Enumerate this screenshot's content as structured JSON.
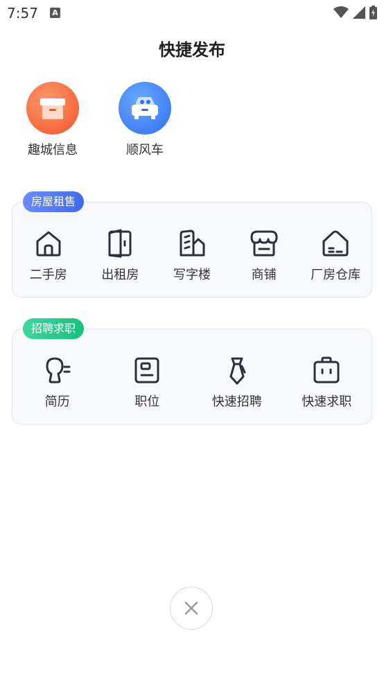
{
  "status_bar": {
    "time": "7:57",
    "notification_badge": "A"
  },
  "header": {
    "title": "快捷发布"
  },
  "quick_actions": [
    {
      "label": "趣城信息",
      "icon": "box-icon",
      "color": "#f0522a"
    },
    {
      "label": "顺风车",
      "icon": "car-icon",
      "color": "#2f6ef2"
    }
  ],
  "sections": {
    "housing": {
      "tag": "房屋租售",
      "items": [
        {
          "label": "二手房",
          "icon": "house-icon"
        },
        {
          "label": "出租房",
          "icon": "door-icon"
        },
        {
          "label": "写字楼",
          "icon": "office-building-icon"
        },
        {
          "label": "商铺",
          "icon": "shop-icon"
        },
        {
          "label": "厂房仓库",
          "icon": "warehouse-icon"
        }
      ]
    },
    "jobs": {
      "tag": "招聘求职",
      "items": [
        {
          "label": "简历",
          "icon": "resume-icon"
        },
        {
          "label": "职位",
          "icon": "position-icon"
        },
        {
          "label": "快速招聘",
          "icon": "tie-icon"
        },
        {
          "label": "快速求职",
          "icon": "briefcase-icon"
        }
      ]
    }
  },
  "colors": {
    "housing_tag": "#3e6bf0",
    "jobs_tag": "#19c07b",
    "card_bg": "#f7f9fc"
  }
}
